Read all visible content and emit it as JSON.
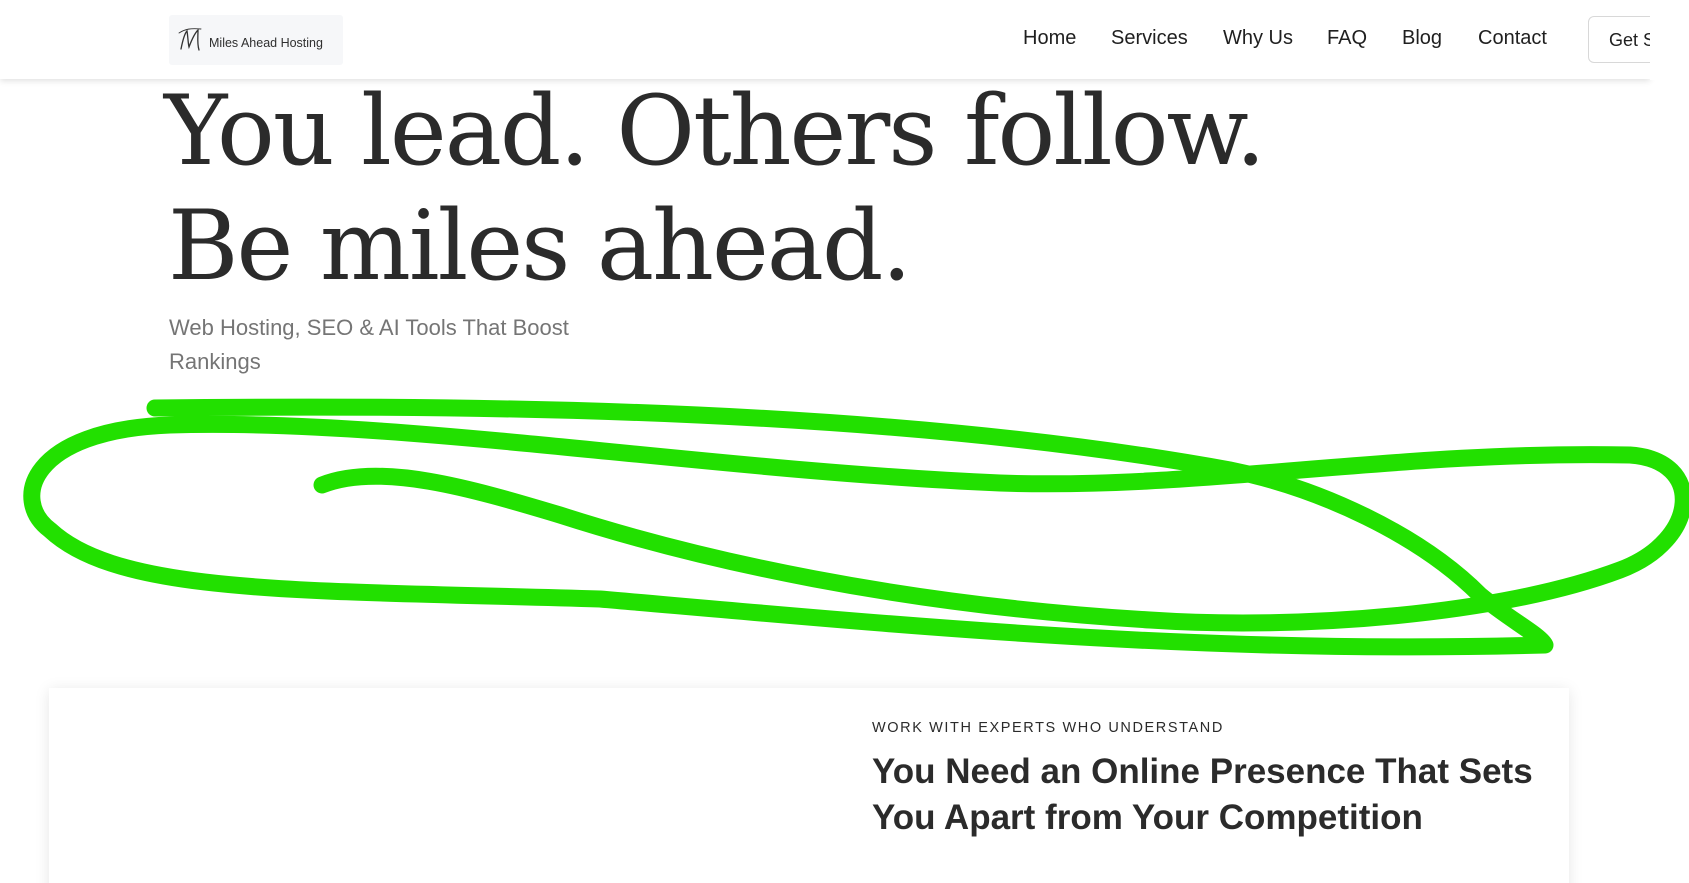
{
  "header": {
    "logo_text": "Miles Ahead Hosting",
    "logo_mark": "M",
    "nav": [
      "Home",
      "Services",
      "Why Us",
      "FAQ",
      "Blog",
      "Contact"
    ],
    "cta_label": "Get S"
  },
  "hero": {
    "title_line1": "You lead. Others follow.",
    "title_line2": "Be miles ahead.",
    "subtitle": "Web Hosting, SEO & AI Tools That Boost Rankings"
  },
  "section": {
    "eyebrow": "WORK WITH EXPERTS WHO UNDERSTAND",
    "title": "You Need an Online Presence That Sets You Apart from Your Competition"
  },
  "annotation": {
    "icon": "freehand-scribble",
    "color": "#22e000"
  },
  "colors": {
    "text": "#2b2b2b",
    "subtitle": "#757575",
    "background": "#ffffff"
  }
}
